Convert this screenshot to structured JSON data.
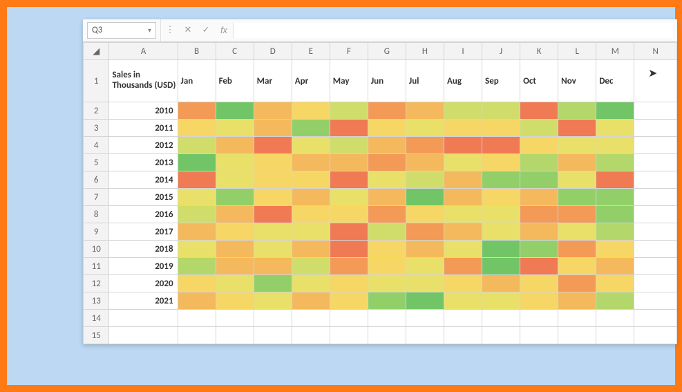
{
  "namebox": {
    "value": "Q3"
  },
  "formula_bar_value": "",
  "icons": {
    "dropdown": "▾",
    "cancel": "✕",
    "accept": "✓",
    "fx": "fx",
    "menu": "⋮"
  },
  "col_letters": [
    "A",
    "B",
    "C",
    "D",
    "E",
    "F",
    "G",
    "H",
    "I",
    "J",
    "K",
    "L",
    "M",
    "N"
  ],
  "row1_header": "Sales in Thousands (USD)",
  "months": [
    "Jan",
    "Feb",
    "Mar",
    "Apr",
    "May",
    "Jun",
    "Jul",
    "Aug",
    "Sep",
    "Oct",
    "Nov",
    "Dec"
  ],
  "years": [
    "2010",
    "2011",
    "2012",
    "2013",
    "2014",
    "2015",
    "2016",
    "2017",
    "2018",
    "2019",
    "2020",
    "2021"
  ],
  "row_numbers": [
    "1",
    "2",
    "3",
    "4",
    "5",
    "6",
    "7",
    "8",
    "9",
    "10",
    "11",
    "12",
    "13",
    "14",
    "15"
  ],
  "chart_data": {
    "type": "heatmap",
    "title": "Sales in Thousands (USD)",
    "categories_x": [
      "Jan",
      "Feb",
      "Mar",
      "Apr",
      "May",
      "Jun",
      "Jul",
      "Aug",
      "Sep",
      "Oct",
      "Nov",
      "Dec"
    ],
    "categories_y": [
      "2010",
      "2011",
      "2012",
      "2013",
      "2014",
      "2015",
      "2016",
      "2017",
      "2018",
      "2019",
      "2020",
      "2021"
    ],
    "scale": {
      "min": 0,
      "max": 10,
      "note": "relative intensity 0=low/red 5=mid/yellow 10=high/green (underlying USD values not printed)"
    },
    "values": [
      [
        2,
        9,
        3,
        4,
        6,
        2,
        3,
        6,
        6,
        1,
        7,
        9
      ],
      [
        4,
        5,
        3,
        8,
        1,
        4,
        5,
        4,
        4,
        6,
        1,
        5
      ],
      [
        6,
        3,
        1,
        5,
        6,
        3,
        2,
        1,
        1,
        4,
        5,
        5
      ],
      [
        9,
        5,
        4,
        3,
        3,
        2,
        3,
        5,
        4,
        7,
        3,
        7
      ],
      [
        1,
        5,
        4,
        4,
        1,
        5,
        6,
        3,
        8,
        8,
        5,
        1
      ],
      [
        5,
        8,
        4,
        3,
        5,
        3,
        9,
        3,
        4,
        3,
        8,
        8
      ],
      [
        6,
        3,
        1,
        4,
        4,
        2,
        4,
        5,
        5,
        2,
        2,
        8
      ],
      [
        3,
        4,
        5,
        5,
        1,
        6,
        2,
        3,
        5,
        3,
        5,
        7
      ],
      [
        5,
        3,
        5,
        3,
        1,
        4,
        3,
        5,
        9,
        8,
        2,
        4
      ],
      [
        7,
        3,
        3,
        6,
        2,
        4,
        5,
        2,
        9,
        1,
        4,
        3
      ],
      [
        4,
        5,
        8,
        5,
        4,
        5,
        5,
        4,
        3,
        4,
        2,
        4
      ],
      [
        3,
        4,
        5,
        3,
        4,
        8,
        9,
        5,
        5,
        4,
        3,
        7
      ]
    ]
  },
  "colors": {
    "border": "#ff7a14",
    "bg": "#bcd8f2",
    "heat": [
      "#ea5b4f",
      "#ef7a53",
      "#f29a56",
      "#f4b95c",
      "#f6d765",
      "#e9e06a",
      "#d1dd6b",
      "#b3d76a",
      "#92cf69",
      "#72c566",
      "#54ba62"
    ]
  }
}
